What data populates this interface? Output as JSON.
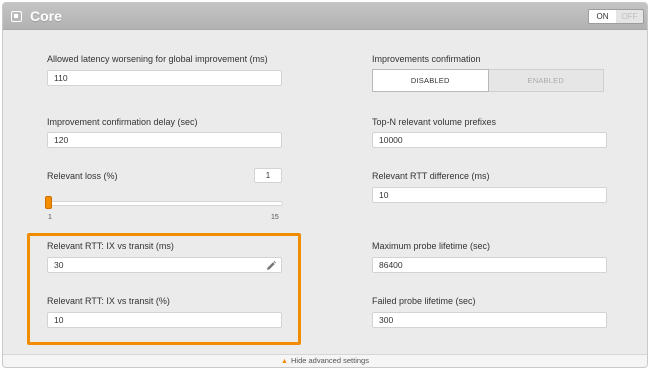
{
  "header": {
    "title": "Core",
    "toggle_on": "ON",
    "toggle_off": "OFF",
    "icon": "core-settings-icon"
  },
  "left": {
    "latency_label": "Allowed latency worsening for global improvement (ms)",
    "latency_value": "110",
    "delay_label": "Improvement confirmation delay (sec)",
    "delay_value": "120",
    "loss_label": "Relevant loss (%)",
    "loss_value": "1",
    "loss_slider": {
      "min": "1",
      "max": "15",
      "current": 1
    },
    "rtt_ms_label": "Relevant RTT: IX vs transit (ms)",
    "rtt_ms_value": "30",
    "rtt_pct_label": "Relevant RTT: IX vs transit (%)",
    "rtt_pct_value": "10"
  },
  "right": {
    "confirm_label": "Improvements confirmation",
    "confirm_options": [
      "DISABLED",
      "ENABLED"
    ],
    "confirm_selected": "DISABLED",
    "topn_label": "Top-N relevant volume prefixes",
    "topn_value": "10000",
    "rtt_diff_label": "Relevant RTT difference (ms)",
    "rtt_diff_value": "10",
    "max_probe_label": "Maximum probe lifetime (sec)",
    "max_probe_value": "86400",
    "failed_probe_label": "Failed probe lifetime (sec)",
    "failed_probe_value": "300"
  },
  "footer": {
    "text": "Hide advanced settings"
  },
  "colors": {
    "accent": "#f28c00",
    "header_bg": "#b8b8b8",
    "panel_bg": "#ebebeb"
  }
}
